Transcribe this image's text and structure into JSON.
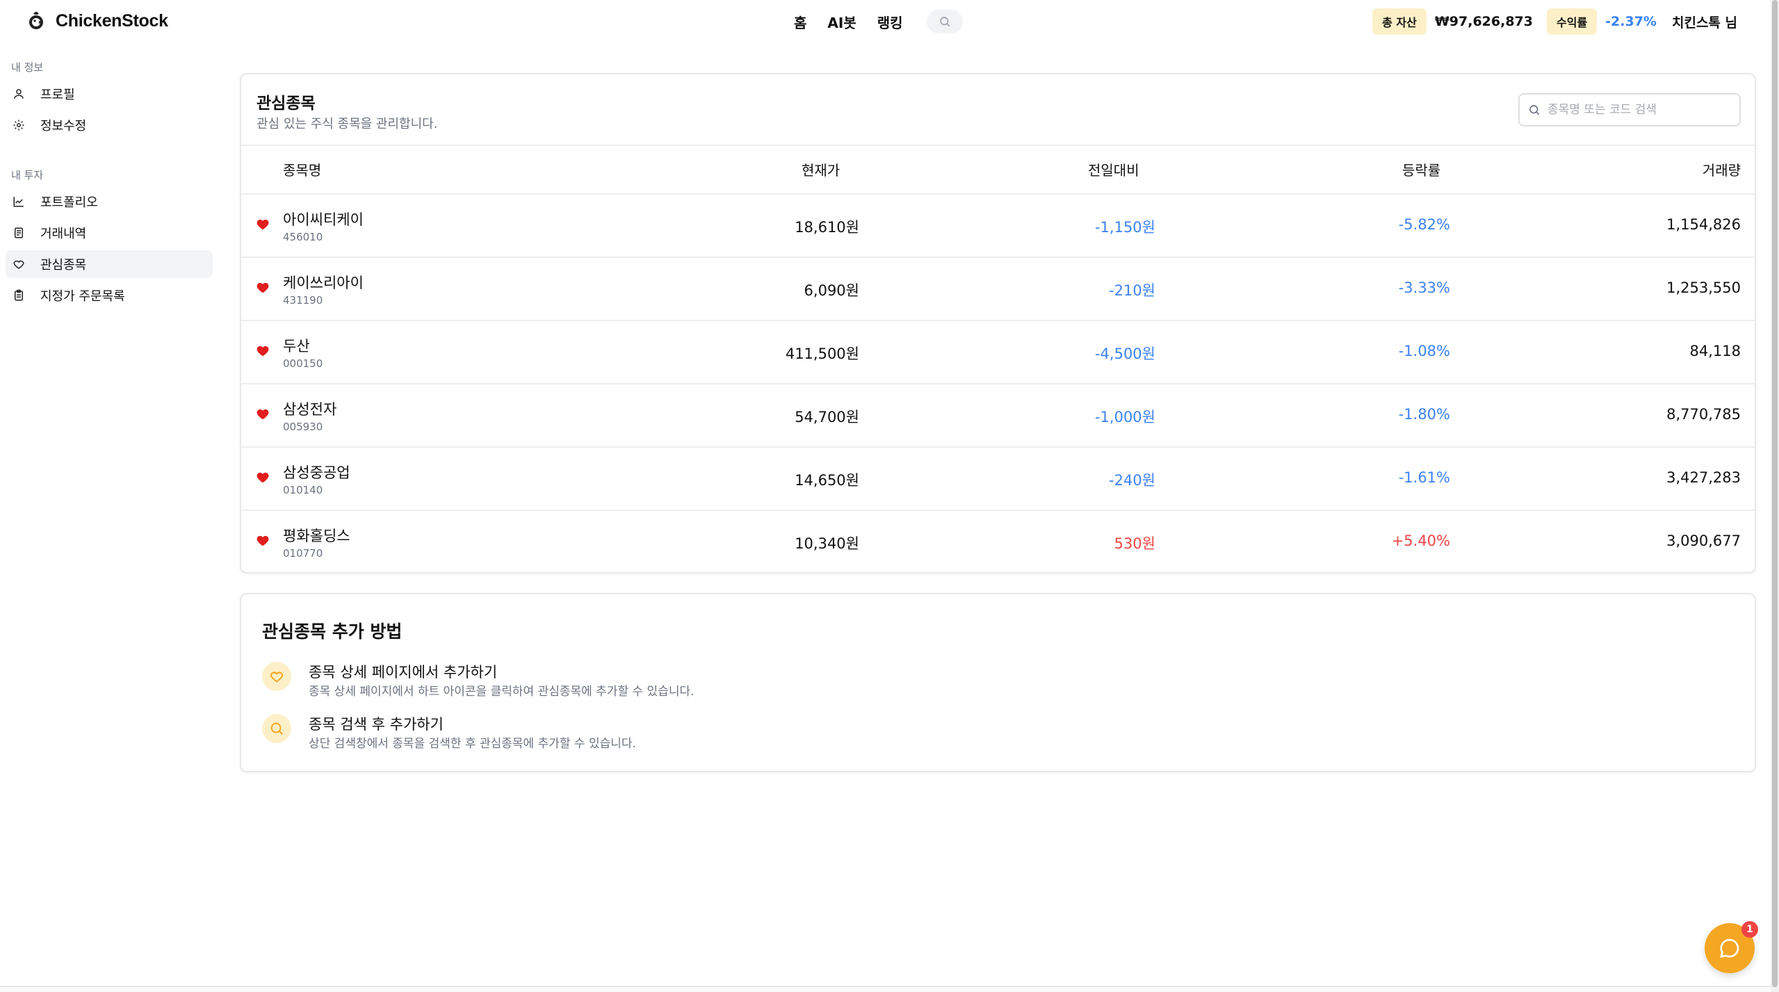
{
  "header": {
    "logo_text": "ChickenStock",
    "nav": [
      "홈",
      "AI봇",
      "랭킹"
    ],
    "total_asset_label": "총 자산",
    "total_asset_value": "₩97,626,873",
    "return_label": "수익률",
    "return_value": "-2.37%",
    "user_name": "치킨스톡 님"
  },
  "sidebar": {
    "section_info": "내 정보",
    "items_info": [
      {
        "label": "프로필",
        "icon": "user-icon"
      },
      {
        "label": "정보수정",
        "icon": "gear-icon"
      }
    ],
    "section_invest": "내 투자",
    "items_invest": [
      {
        "label": "포트폴리오",
        "icon": "chart-icon"
      },
      {
        "label": "거래내역",
        "icon": "document-icon"
      },
      {
        "label": "관심종목",
        "icon": "heart-icon",
        "active": true
      },
      {
        "label": "지정가 주문목록",
        "icon": "clipboard-icon"
      }
    ]
  },
  "watchlist": {
    "title": "관심종목",
    "subtitle": "관심 있는 주식 종목을 관리합니다.",
    "search_placeholder": "종목명 또는 코드 검색",
    "columns": [
      "종목명",
      "현재가",
      "전일대비",
      "등락률",
      "거래량"
    ],
    "rows": [
      {
        "name": "아이씨티케이",
        "code": "456010",
        "price": "18,610원",
        "change": "-1,150원",
        "rate": "-5.82%",
        "volume": "1,154,826",
        "direction": "down"
      },
      {
        "name": "케이쓰리아이",
        "code": "431190",
        "price": "6,090원",
        "change": "-210원",
        "rate": "-3.33%",
        "volume": "1,253,550",
        "direction": "down"
      },
      {
        "name": "두산",
        "code": "000150",
        "price": "411,500원",
        "change": "-4,500원",
        "rate": "-1.08%",
        "volume": "84,118",
        "direction": "down"
      },
      {
        "name": "삼성전자",
        "code": "005930",
        "price": "54,700원",
        "change": "-1,000원",
        "rate": "-1.80%",
        "volume": "8,770,785",
        "direction": "down"
      },
      {
        "name": "삼성중공업",
        "code": "010140",
        "price": "14,650원",
        "change": "-240원",
        "rate": "-1.61%",
        "volume": "3,427,283",
        "direction": "down"
      },
      {
        "name": "평화홀딩스",
        "code": "010770",
        "price": "10,340원",
        "change": "530원",
        "rate": "+5.40%",
        "volume": "3,090,677",
        "direction": "up"
      }
    ]
  },
  "howto": {
    "title": "관심종목 추가 방법",
    "tips": [
      {
        "title": "종목 상세 페이지에서 추가하기",
        "desc": "종목 상세 페이지에서 하트 아이콘을 클릭하여 관심종목에 추가할 수 있습니다.",
        "icon": "heart-outline-icon"
      },
      {
        "title": "종목 검색 후 추가하기",
        "desc": "상단 검색창에서 종목을 검색한 후 관심종목에 추가할 수 있습니다.",
        "icon": "search-icon"
      }
    ]
  },
  "chat": {
    "badge_count": "1"
  },
  "colors": {
    "accent": "#f5a623",
    "pill_bg": "#fdf0c8",
    "down": "#3b82f6",
    "up": "#ef4444",
    "heart": "#e11d1d"
  }
}
